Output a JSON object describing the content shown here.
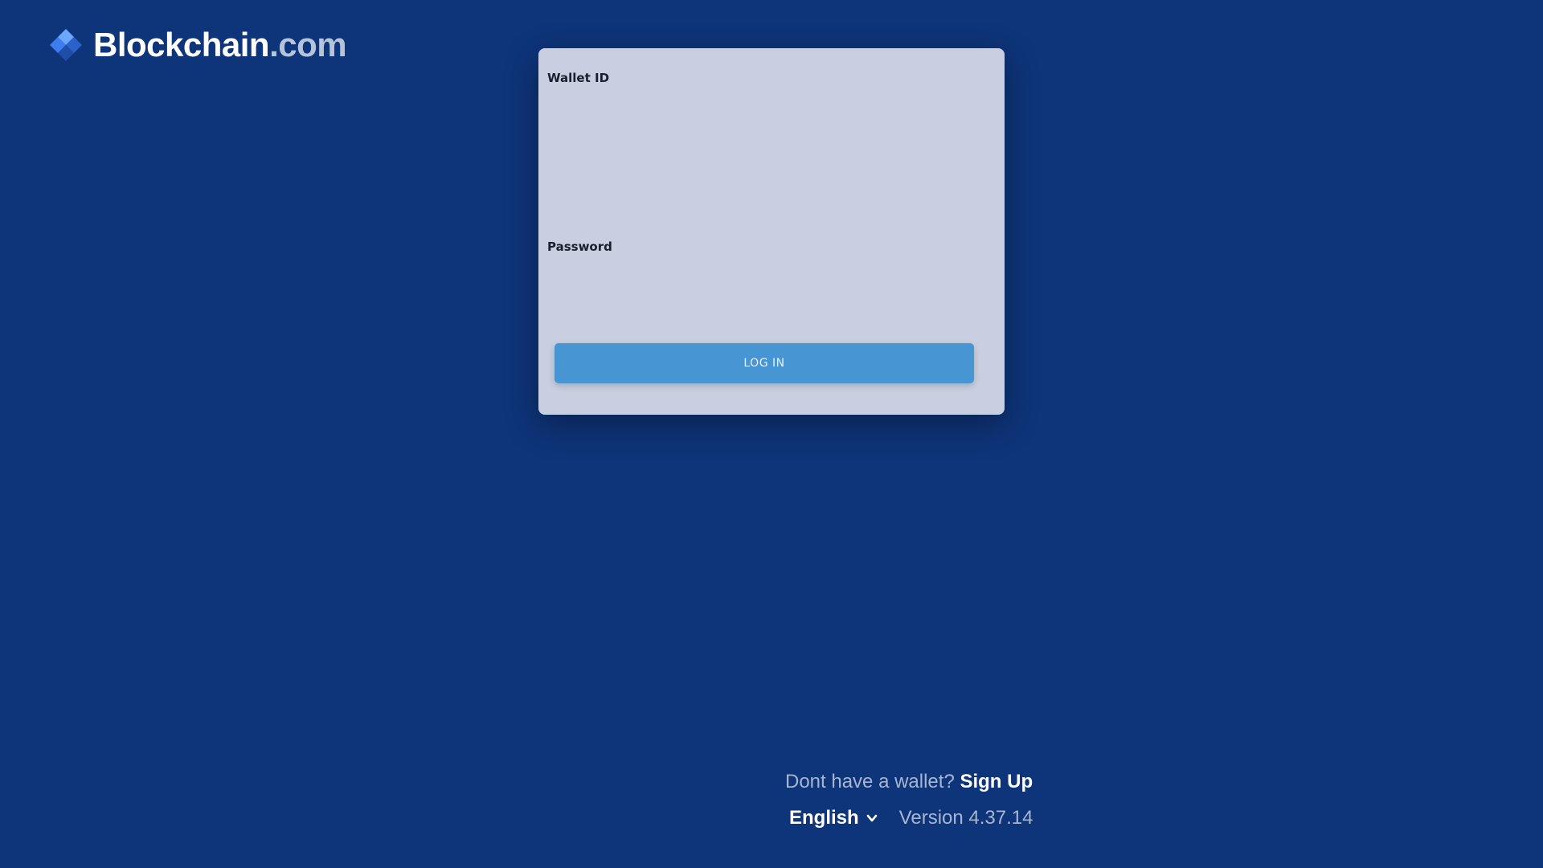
{
  "brand": {
    "name": "Blockchain",
    "tld": ".com",
    "icon": "blockchain-logo-icon"
  },
  "login_form": {
    "wallet_id_label": "Wallet ID",
    "wallet_id_value": "",
    "password_label": "Password",
    "password_value": "",
    "login_button_label": "LOG IN"
  },
  "footer": {
    "signup_prompt": "Dont have a wallet?",
    "signup_link": "Sign Up",
    "language": "English",
    "language_icon": "chevron-down-icon",
    "version": "Version 4.37.14"
  },
  "colors": {
    "background": "#0e3479",
    "card": "#c7cfe0",
    "button": "#4796d3",
    "logo_accent": "#3c7ef0"
  }
}
